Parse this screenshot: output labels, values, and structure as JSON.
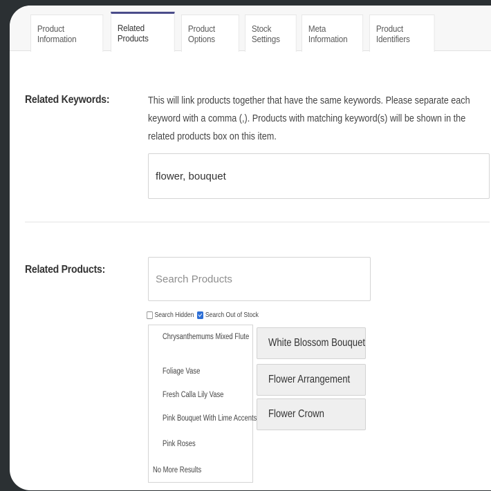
{
  "tabs": [
    {
      "label": "Product Information"
    },
    {
      "label": "Related Products"
    },
    {
      "label": "Product Options"
    },
    {
      "label": "Stock Settings"
    },
    {
      "label": "Meta Information"
    },
    {
      "label": "Product Identifiers"
    }
  ],
  "active_tab": "Related Products",
  "related_keywords": {
    "label": "Related Keywords:",
    "help": "This will link products together that have the same keywords. Please separate each keyword with a comma (,). Products with matching keyword(s) will be shown in the related products box on this item.",
    "value": "flower, bouquet"
  },
  "related_products": {
    "label": "Related Products:",
    "search_placeholder": "Search Products",
    "search_hidden_label": "Search Hidden",
    "search_hidden_checked": false,
    "search_out_of_stock_label": "Search Out of Stock",
    "search_out_of_stock_checked": true,
    "results": [
      "Chrysanthemums Mixed Flute",
      "Foliage Vase",
      "Fresh Calla Lily Vase",
      "Pink Bouquet With Lime Accents",
      "Pink Roses"
    ],
    "no_more_results": "No More Results",
    "selected": [
      "White Blossom Bouquet",
      "Flower Arrangement",
      "Flower Crown"
    ]
  },
  "colors": {
    "background": "#2b3033",
    "active_tab_accent": "#4a4c8a",
    "checkbox_checked": "#2d6fd6"
  }
}
